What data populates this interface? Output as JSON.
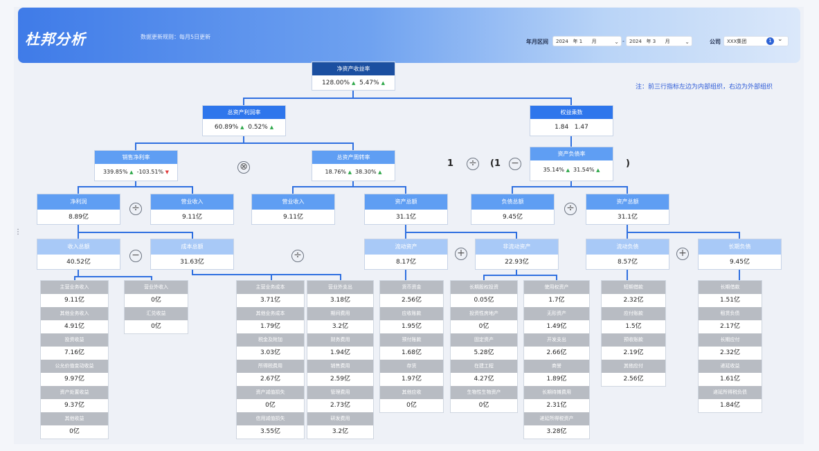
{
  "header": {
    "title": "杜邦分析",
    "update_rule": "数据更新规则：每月5日更新",
    "period_label": "年月区间",
    "start_year": "2024",
    "start_year_unit": "年 1",
    "start_month_unit": "月",
    "dash": "-",
    "end_year": "2024",
    "end_year_unit": "年 3",
    "end_month_unit": "月",
    "company_label": "公司",
    "company_value": "XXX集团",
    "info_badge": "1"
  },
  "note": "注：前三行指标左边为内部组织，右边为外部组织",
  "nodes": {
    "roe": {
      "label": "净资产收益率",
      "v1": "128.00%",
      "v2": "5.47%"
    },
    "roa": {
      "label": "总资产利润率",
      "v1": "60.89%",
      "v2": "0.52%"
    },
    "equity_multiplier": {
      "label": "权益乘数",
      "v1": "1.84",
      "v2": "1.47"
    },
    "net_margin": {
      "label": "销售净利率",
      "v1": "339.85%",
      "v2": "-103.51%"
    },
    "asset_turnover": {
      "label": "总资产周转率",
      "v1": "18.76%",
      "v2": "38.30%"
    },
    "debt_ratio": {
      "label": "资产负债率",
      "v1": "35.14%",
      "v2": "31.54%"
    },
    "net_profit": {
      "label": "净利润",
      "v": "8.89亿"
    },
    "revenue_a": {
      "label": "营业收入",
      "v": "9.11亿"
    },
    "revenue_b": {
      "label": "营业收入",
      "v": "9.11亿"
    },
    "total_assets_a": {
      "label": "资产总额",
      "v": "31.1亿"
    },
    "total_liabilities": {
      "label": "负债总额",
      "v": "9.45亿"
    },
    "total_assets_b": {
      "label": "资产总额",
      "v": "31.1亿"
    },
    "total_income": {
      "label": "收入总额",
      "v": "40.52亿"
    },
    "total_cost": {
      "label": "成本总额",
      "v": "31.63亿"
    },
    "current_assets": {
      "label": "流动资产",
      "v": "8.17亿"
    },
    "noncurrent_assets": {
      "label": "非流动资产",
      "v": "22.93亿"
    },
    "current_liabilities": {
      "label": "流动负债",
      "v": "8.57亿"
    },
    "longterm_liabilities": {
      "label": "长期负债",
      "v": "9.45亿"
    }
  },
  "formula": {
    "one": "1",
    "open": "(1",
    "close": ")"
  },
  "operators": {
    "times": "⊗",
    "divide": "÷",
    "minus": "−",
    "plus": "+"
  },
  "leaf_cols": [
    {
      "id": "c1",
      "items": [
        {
          "l": "主营业务收入",
          "v": "9.11亿"
        },
        {
          "l": "其他业务收入",
          "v": "4.91亿"
        },
        {
          "l": "投资收益",
          "v": "7.16亿"
        },
        {
          "l": "公允价值变动收益",
          "v": "9.97亿"
        },
        {
          "l": "资产处置收益",
          "v": "9.37亿"
        },
        {
          "l": "其他收益",
          "v": "0亿"
        }
      ]
    },
    {
      "id": "c2",
      "items": [
        {
          "l": "营业外收入",
          "v": "0亿"
        },
        {
          "l": "汇兑收益",
          "v": "0亿"
        }
      ]
    },
    {
      "id": "c3",
      "items": [
        {
          "l": "主营业务成本",
          "v": "3.71亿"
        },
        {
          "l": "其他业务成本",
          "v": "1.79亿"
        },
        {
          "l": "税金及附加",
          "v": "3.03亿"
        },
        {
          "l": "所得税费用",
          "v": "2.67亿"
        },
        {
          "l": "资产减值损失",
          "v": "0亿"
        },
        {
          "l": "信用减值损失",
          "v": "3.55亿"
        }
      ]
    },
    {
      "id": "c4",
      "items": [
        {
          "l": "营业外支出",
          "v": "3.18亿"
        },
        {
          "l": "期间费用",
          "v": "3.2亿"
        },
        {
          "l": "财务费用",
          "v": "1.94亿"
        },
        {
          "l": "销售费用",
          "v": "2.59亿"
        },
        {
          "l": "管理费用",
          "v": "2.73亿"
        },
        {
          "l": "研发费用",
          "v": "3.2亿"
        }
      ]
    },
    {
      "id": "c5",
      "items": [
        {
          "l": "货币资金",
          "v": "2.56亿"
        },
        {
          "l": "应收账款",
          "v": "1.95亿"
        },
        {
          "l": "预付账款",
          "v": "1.68亿"
        },
        {
          "l": "存货",
          "v": "1.97亿"
        },
        {
          "l": "其他应收",
          "v": "0亿"
        }
      ]
    },
    {
      "id": "c6",
      "items": [
        {
          "l": "长期股权投资",
          "v": "0.05亿"
        },
        {
          "l": "投资性房地产",
          "v": "0亿"
        },
        {
          "l": "固定资产",
          "v": "5.28亿"
        },
        {
          "l": "在建工程",
          "v": "4.27亿"
        },
        {
          "l": "生物性生物资产",
          "v": "0亿"
        }
      ]
    },
    {
      "id": "c7",
      "items": [
        {
          "l": "使用权资产",
          "v": "1.7亿"
        },
        {
          "l": "无形资产",
          "v": "1.49亿"
        },
        {
          "l": "开发支出",
          "v": "2.66亿"
        },
        {
          "l": "商誉",
          "v": "1.89亿"
        },
        {
          "l": "长期待摊费用",
          "v": "2.31亿"
        },
        {
          "l": "递延所得税资产",
          "v": "3.28亿"
        }
      ]
    },
    {
      "id": "c8",
      "items": [
        {
          "l": "短期借款",
          "v": "2.32亿"
        },
        {
          "l": "应付账款",
          "v": "1.5亿"
        },
        {
          "l": "预收账款",
          "v": "2.19亿"
        },
        {
          "l": "其他应付",
          "v": "2.56亿"
        }
      ]
    },
    {
      "id": "c9",
      "items": [
        {
          "l": "长期借款",
          "v": "1.51亿"
        },
        {
          "l": "租赁负债",
          "v": "2.17亿"
        },
        {
          "l": "长期应付",
          "v": "2.32亿"
        },
        {
          "l": "递延收益",
          "v": "1.61亿"
        },
        {
          "l": "递延所得税负债",
          "v": "1.84亿"
        }
      ]
    }
  ]
}
